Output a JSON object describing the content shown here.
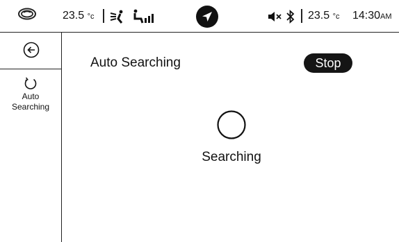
{
  "status_bar": {
    "left_temp": "23.5",
    "left_temp_unit": "°c",
    "right_temp": "23.5",
    "right_temp_unit": "°c",
    "time": "14:30",
    "time_suffix": "AM"
  },
  "sidebar": {
    "items": [
      {
        "label_line1": "Auto",
        "label_line2": "Searching",
        "icon": "refresh-icon"
      }
    ]
  },
  "main": {
    "title": "Auto Searching",
    "stop_label": "Stop",
    "status_text": "Searching"
  }
}
